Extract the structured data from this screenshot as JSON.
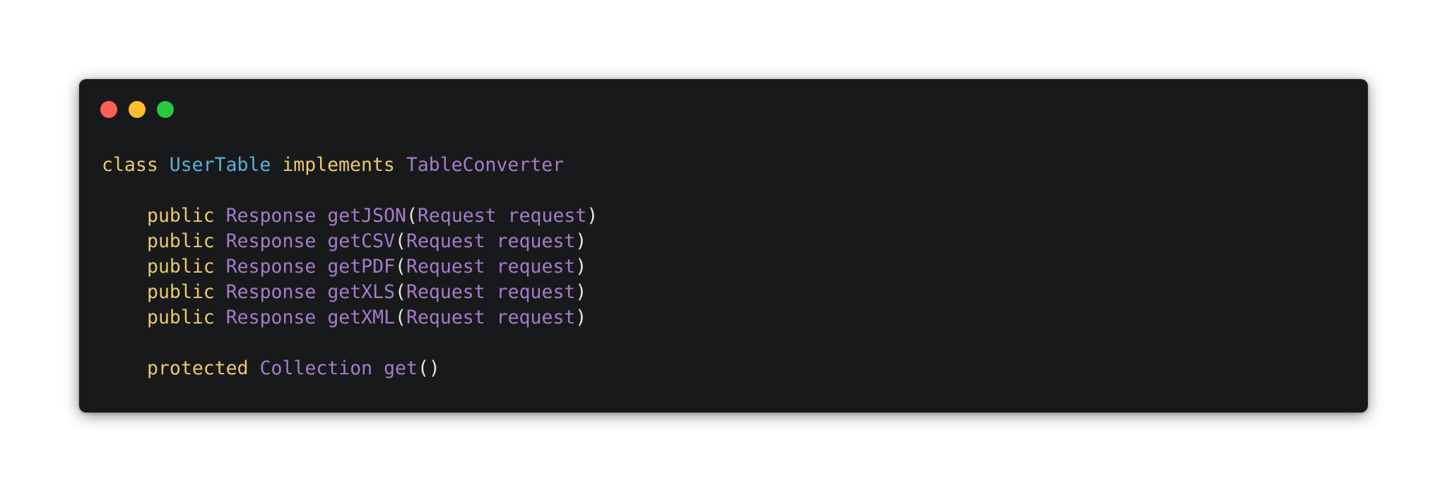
{
  "window": {
    "traffic_lights": {
      "close_color": "#ff5f56",
      "minimize_color": "#ffbd2e",
      "maximize_color": "#27c93f"
    }
  },
  "code": {
    "class_line": {
      "keyword": "class",
      "class_name": "UserTable",
      "implements_keyword": "implements",
      "interface_name": "TableConverter"
    },
    "methods": [
      {
        "modifier": "public",
        "return_type": "Response",
        "name": "getJSON",
        "open_paren": "(",
        "param_type": "Request",
        "param_name": "request",
        "close_paren": ")"
      },
      {
        "modifier": "public",
        "return_type": "Response",
        "name": "getCSV",
        "open_paren": "(",
        "param_type": "Request",
        "param_name": "request",
        "close_paren": ")"
      },
      {
        "modifier": "public",
        "return_type": "Response",
        "name": "getPDF",
        "open_paren": "(",
        "param_type": "Request",
        "param_name": "request",
        "close_paren": ")"
      },
      {
        "modifier": "public",
        "return_type": "Response",
        "name": "getXLS",
        "open_paren": "(",
        "param_type": "Request",
        "param_name": "request",
        "close_paren": ")"
      },
      {
        "modifier": "public",
        "return_type": "Response",
        "name": "getXML",
        "open_paren": "(",
        "param_type": "Request",
        "param_name": "request",
        "close_paren": ")"
      }
    ],
    "protected_method": {
      "modifier": "protected",
      "return_type": "Collection",
      "name": "get",
      "parens": "()"
    },
    "colors": {
      "background": "#18191b",
      "keyword": "#ecc96a",
      "class_name": "#5db0d7",
      "type": "#a57cc9",
      "punctuation": "#e6e6e6"
    }
  }
}
